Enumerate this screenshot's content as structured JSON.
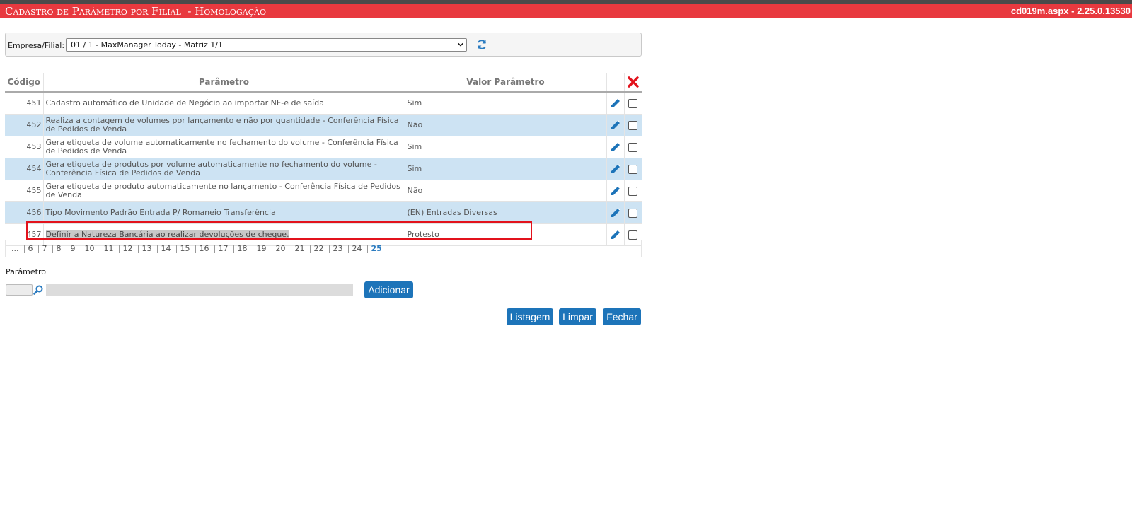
{
  "window": {
    "title": "Cadastro de Parâmetro por Filial  - Homologação",
    "version": "cd019m.aspx - 2.25.0.13530"
  },
  "filter": {
    "label": "Empresa/Filial:",
    "selected": "01 / 1 - MaxManager Today - Matriz 1/1",
    "refresh_icon": "refresh-icon"
  },
  "table": {
    "headers": {
      "code": "Código",
      "param": "Parâmetro",
      "value": "Valor Parâmetro",
      "delete_icon": "delete-x-icon"
    },
    "rows": [
      {
        "code": "451",
        "param": "Cadastro automático de Unidade de Negócio ao importar NF-e de saída",
        "value": "Sim"
      },
      {
        "code": "452",
        "param": "Realiza a contagem de volumes por lançamento e não por quantidade - Conferência Física de Pedidos de Venda",
        "value": "Não"
      },
      {
        "code": "453",
        "param": "Gera etiqueta de volume automaticamente no fechamento do volume - Conferência Física de Pedidos de Venda",
        "value": "Sim"
      },
      {
        "code": "454",
        "param": "Gera etiqueta de produtos por volume automaticamente no fechamento do volume - Conferência Física de Pedidos de Venda",
        "value": "Sim"
      },
      {
        "code": "455",
        "param": "Gera etiqueta de produto automaticamente no lançamento - Conferência Física de Pedidos de Venda",
        "value": "Não"
      },
      {
        "code": "456",
        "param": "Tipo Movimento Padrão Entrada P/ Romaneio Transferência",
        "value": "(EN) Entradas Diversas"
      },
      {
        "code": "457",
        "param": "Definir a Natureza Bancária ao realizar devoluções de cheque.",
        "value": "Protesto"
      }
    ],
    "highlight_color": "#e2121c"
  },
  "pager": {
    "pages": [
      "...",
      "6",
      "7",
      "8",
      "9",
      "10",
      "11",
      "12",
      "13",
      "14",
      "15",
      "16",
      "17",
      "18",
      "19",
      "20",
      "21",
      "22",
      "23",
      "24",
      "25"
    ],
    "current": "25"
  },
  "form": {
    "param_label": "Parâmetro",
    "add_button": "Adicionar",
    "lookup_icon": "lookup-icon"
  },
  "actions": {
    "listagem": "Listagem",
    "limpar": "Limpar",
    "fechar": "Fechar"
  },
  "colors": {
    "titlebar": "#e8393f",
    "row_alt": "#cde3f3",
    "button": "#1d74b9"
  }
}
